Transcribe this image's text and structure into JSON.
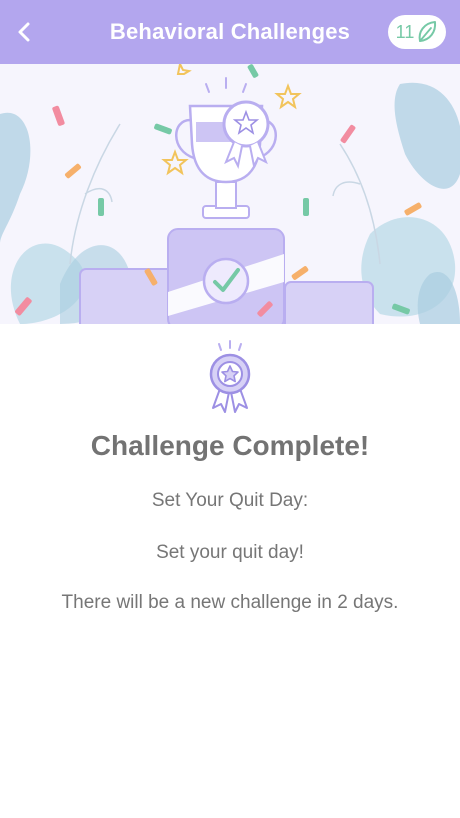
{
  "header": {
    "title": "Behavioral Challenges",
    "back_icon": "chevron-left-icon",
    "badge": {
      "count": "11",
      "icon": "leaf-icon"
    }
  },
  "hero": {
    "image": "trophy-podium-confetti-illustration"
  },
  "content": {
    "medal_icon": "medal-icon",
    "title": "Challenge Complete!",
    "challenge_name": "Set Your Quit Day:",
    "challenge_desc": "Set your quit day!",
    "next_notice": "There will be a new challenge in 2 days."
  },
  "colors": {
    "header_bg": "#b3a6ee",
    "accent_purple": "#b9aef0",
    "accent_green": "#76c9a6",
    "text_gray": "#767676"
  }
}
